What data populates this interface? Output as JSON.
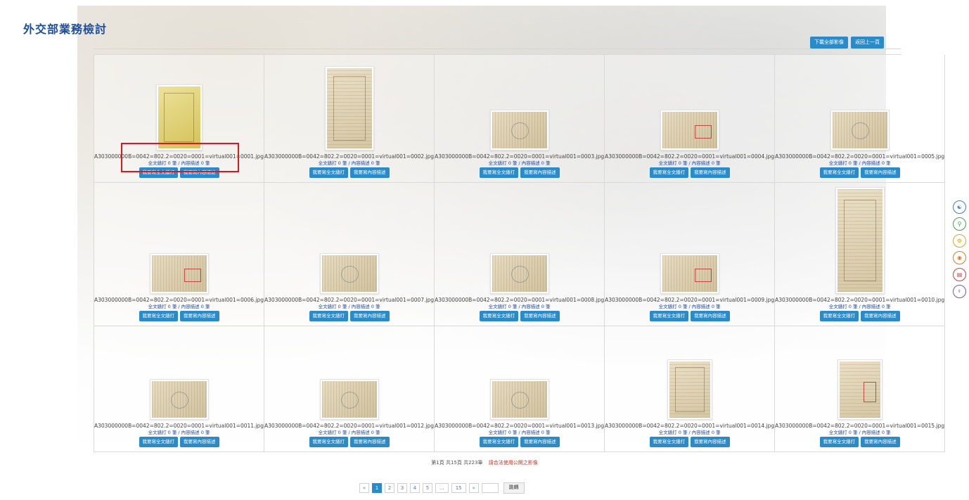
{
  "page": {
    "title": "外交部業務檢討"
  },
  "top_actions": {
    "download_all": "下載全部影像",
    "back": "返回上一頁"
  },
  "item_labels": {
    "counts": "全文繕打 0 筆 / 內容描述 0 筆",
    "btn_fulltext": "我要寫全文繕打",
    "btn_description": "我要寫內容描述"
  },
  "items": [
    {
      "filename": "A303000000B=0042=802.2=0020=0001=virtual001=0001.jpg",
      "thumb": "yellow-cover"
    },
    {
      "filename": "A303000000B=0042=802.2=0020=0001=virtual001=0002.jpg",
      "thumb": "tall-envelope"
    },
    {
      "filename": "A303000000B=0042=802.2=0020=0001=virtual001=0003.jpg",
      "thumb": "wide-letter"
    },
    {
      "filename": "A303000000B=0042=802.2=0020=0001=virtual001=0004.jpg",
      "thumb": "wide-stamp"
    },
    {
      "filename": "A303000000B=0042=802.2=0020=0001=virtual001=0005.jpg",
      "thumb": "wide-letter"
    },
    {
      "filename": "A303000000B=0042=802.2=0020=0001=virtual001=0006.jpg",
      "thumb": "wide-stamp"
    },
    {
      "filename": "A303000000B=0042=802.2=0020=0001=virtual001=0007.jpg",
      "thumb": "wide-letter"
    },
    {
      "filename": "A303000000B=0042=802.2=0020=0001=virtual001=0008.jpg",
      "thumb": "wide-letter"
    },
    {
      "filename": "A303000000B=0042=802.2=0020=0001=virtual001=0009.jpg",
      "thumb": "wide-stamp"
    },
    {
      "filename": "A303000000B=0042=802.2=0020=0001=virtual001=0010.jpg",
      "thumb": "tall-letter"
    },
    {
      "filename": "A303000000B=0042=802.2=0020=0001=virtual001=0011.jpg",
      "thumb": "wide-letter"
    },
    {
      "filename": "A303000000B=0042=802.2=0020=0001=virtual001=0012.jpg",
      "thumb": "wide-letter"
    },
    {
      "filename": "A303000000B=0042=802.2=0020=0001=virtual001=0013.jpg",
      "thumb": "wide-letter"
    },
    {
      "filename": "A303000000B=0042=802.2=0020=0001=virtual001=0014.jpg",
      "thumb": "tall-letter"
    },
    {
      "filename": "A303000000B=0042=802.2=0020=0001=virtual001=0015.jpg",
      "thumb": "tall-stamp"
    }
  ],
  "pagination": {
    "summary": "第1頁 共15頁 共223筆",
    "note": "請合法使用公開之影像",
    "prev": "«",
    "pages": [
      "1",
      "2",
      "3",
      "4",
      "5",
      "...",
      "15"
    ],
    "next": "»",
    "current": "1",
    "jump_label": "跳轉"
  },
  "side_icons": [
    "person-icon",
    "document-search-icon",
    "cart-icon",
    "stamp-icon",
    "report-icon",
    "top-icon"
  ],
  "colors": {
    "accent": "#2a8bc8",
    "title": "#1d4e9e",
    "highlight": "#e0161e"
  }
}
